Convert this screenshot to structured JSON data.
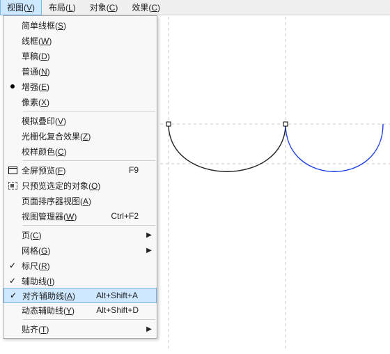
{
  "menubar": {
    "items": [
      {
        "label": "视图(V)",
        "active": true
      },
      {
        "label": "布局(L)",
        "active": false
      },
      {
        "label": "对象(C)",
        "active": false
      },
      {
        "label": "效果(C)",
        "active": false
      }
    ]
  },
  "dropdown": {
    "items": [
      {
        "type": "item",
        "label": "简单线框(S)"
      },
      {
        "type": "item",
        "label": "线框(W)"
      },
      {
        "type": "item",
        "label": "草稿(D)"
      },
      {
        "type": "item",
        "label": "普通(N)"
      },
      {
        "type": "item",
        "label": "增强(E)",
        "icon": "bullet"
      },
      {
        "type": "item",
        "label": "像素(X)"
      },
      {
        "type": "sep"
      },
      {
        "type": "item",
        "label": "模拟叠印(V)"
      },
      {
        "type": "item",
        "label": "光栅化复合效果(Z)"
      },
      {
        "type": "item",
        "label": "校样颜色(C)"
      },
      {
        "type": "sep"
      },
      {
        "type": "item",
        "label": "全屏预览(F)",
        "shortcut": "F9",
        "icon": "fullscreen"
      },
      {
        "type": "item",
        "label": "只预览选定的对象(O)",
        "icon": "selonly"
      },
      {
        "type": "item",
        "label": "页面排序器视图(A)"
      },
      {
        "type": "item",
        "label": "视图管理器(W)",
        "shortcut": "Ctrl+F2"
      },
      {
        "type": "sep"
      },
      {
        "type": "item",
        "label": "页(C)",
        "submenu": true
      },
      {
        "type": "item",
        "label": "网格(G)",
        "submenu": true
      },
      {
        "type": "item",
        "label": "标尺(R)",
        "icon": "check"
      },
      {
        "type": "item",
        "label": "辅助线(I)",
        "icon": "check"
      },
      {
        "type": "item",
        "label": "对齐辅助线(A)",
        "shortcut": "Alt+Shift+A",
        "icon": "check",
        "highlight": true
      },
      {
        "type": "item",
        "label": "动态辅助线(Y)",
        "shortcut": "Alt+Shift+D"
      },
      {
        "type": "sep"
      },
      {
        "type": "item",
        "label": "贴齐(T)",
        "submenu": true
      }
    ]
  },
  "canvas": {
    "curve1_color": "#222222",
    "curve2_color": "#1a3ee8",
    "guide_color": "#c8c8c8"
  }
}
